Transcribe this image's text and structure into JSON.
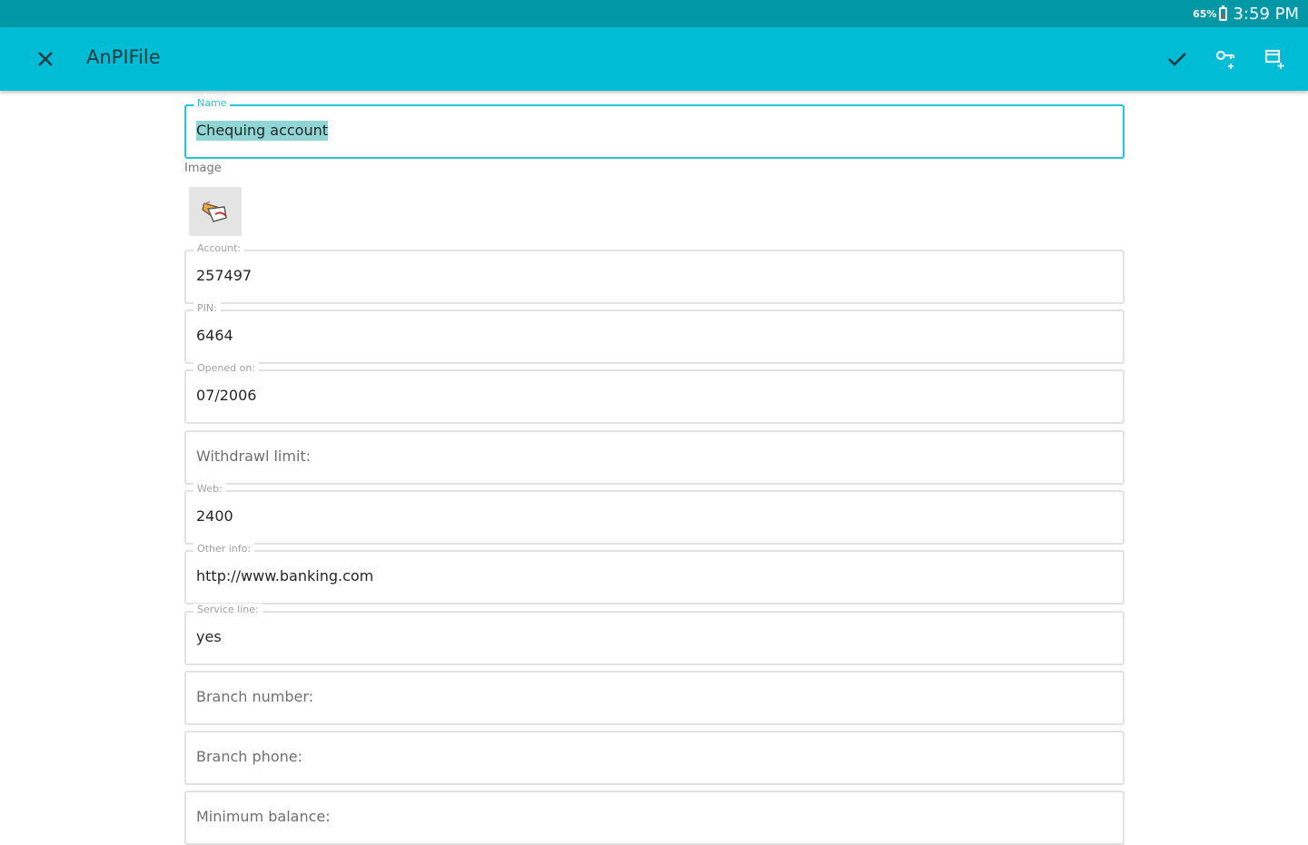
{
  "status_bar": {
    "battery": "65%",
    "time": "3:59 PM"
  },
  "app_bar": {
    "title": "AnPIFile",
    "icons": [
      "close-icon",
      "check-icon",
      "key-add-icon",
      "field-add-icon"
    ]
  },
  "form": {
    "name": {
      "legend": "Name",
      "value": "Chequing account"
    },
    "image_label": "Image",
    "image_icon": "bank-card-image-icon",
    "fields": [
      {
        "legend": "Account:",
        "value": "257497"
      },
      {
        "legend": "PIN:",
        "value": "6464"
      },
      {
        "legend": "Opened on:",
        "value": "07/2006"
      },
      {
        "legend": "",
        "placeholder": "Withdrawl limit:",
        "value": ""
      },
      {
        "legend": "Web:",
        "value": "2400"
      },
      {
        "legend": "Other info:",
        "value": "http://www.banking.com"
      },
      {
        "legend": "Service line:",
        "value": "yes"
      },
      {
        "legend": "",
        "placeholder": "Branch number:",
        "value": ""
      },
      {
        "legend": "",
        "placeholder": "Branch phone:",
        "value": ""
      },
      {
        "legend": "",
        "placeholder": "Minimum balance:",
        "value": ""
      }
    ]
  },
  "colors": {
    "status_bar": "#0097a7",
    "app_bar": "#00bcd4",
    "focus": "#26c6da",
    "selection": "#8fd6d4"
  }
}
